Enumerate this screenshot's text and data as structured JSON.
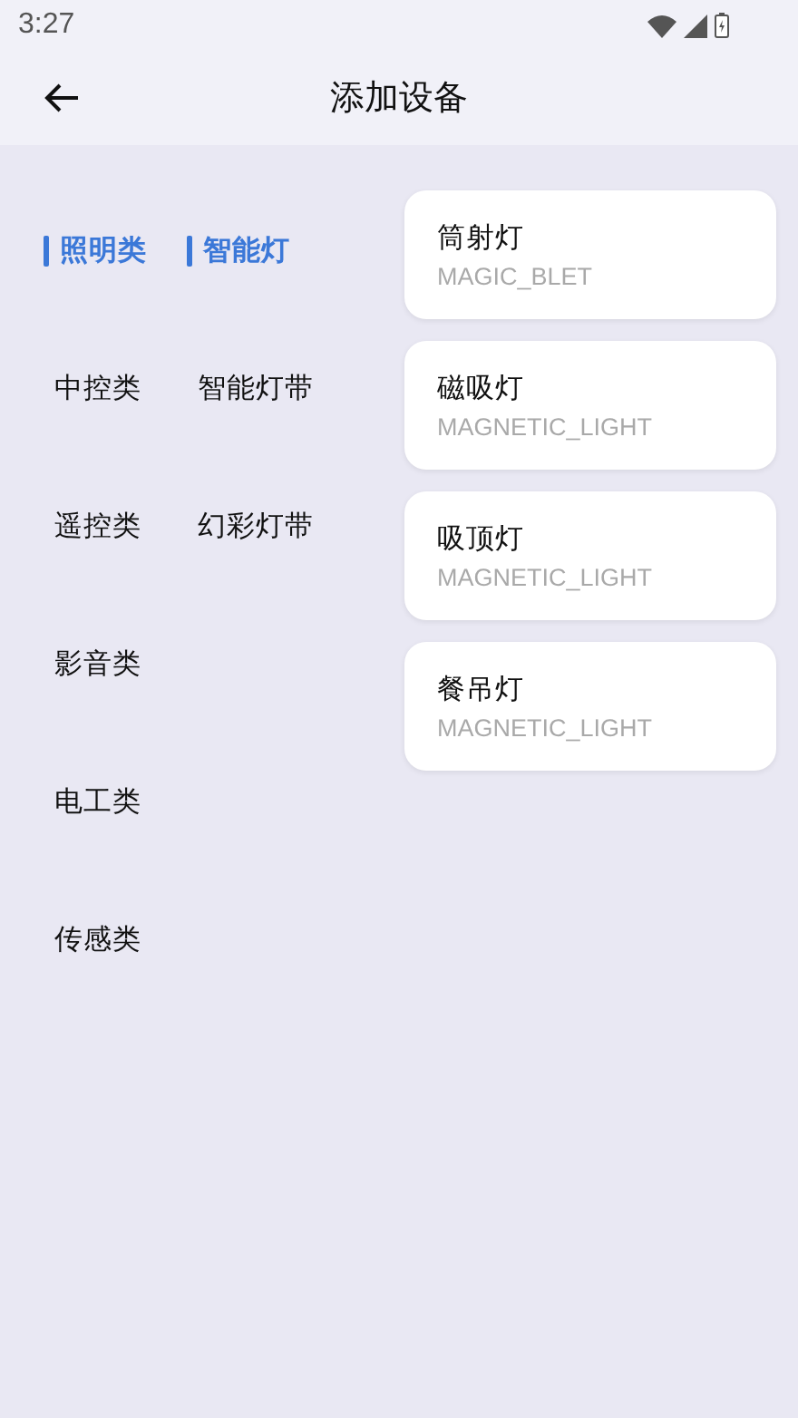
{
  "status_bar": {
    "time": "3:27"
  },
  "header": {
    "title": "添加设备"
  },
  "categories": [
    {
      "label": "照明类",
      "selected": true
    },
    {
      "label": "中控类",
      "selected": false
    },
    {
      "label": "遥控类",
      "selected": false
    },
    {
      "label": "影音类",
      "selected": false
    },
    {
      "label": "电工类",
      "selected": false
    },
    {
      "label": "传感类",
      "selected": false
    }
  ],
  "subcategories": [
    {
      "label": "智能灯",
      "selected": true
    },
    {
      "label": "智能灯带",
      "selected": false
    },
    {
      "label": "幻彩灯带",
      "selected": false
    }
  ],
  "devices": [
    {
      "name": "筒射灯",
      "code": "MAGIC_BLET"
    },
    {
      "name": "磁吸灯",
      "code": "MAGNETIC_LIGHT"
    },
    {
      "name": "吸顶灯",
      "code": "MAGNETIC_LIGHT"
    },
    {
      "name": "餐吊灯",
      "code": "MAGNETIC_LIGHT"
    }
  ]
}
